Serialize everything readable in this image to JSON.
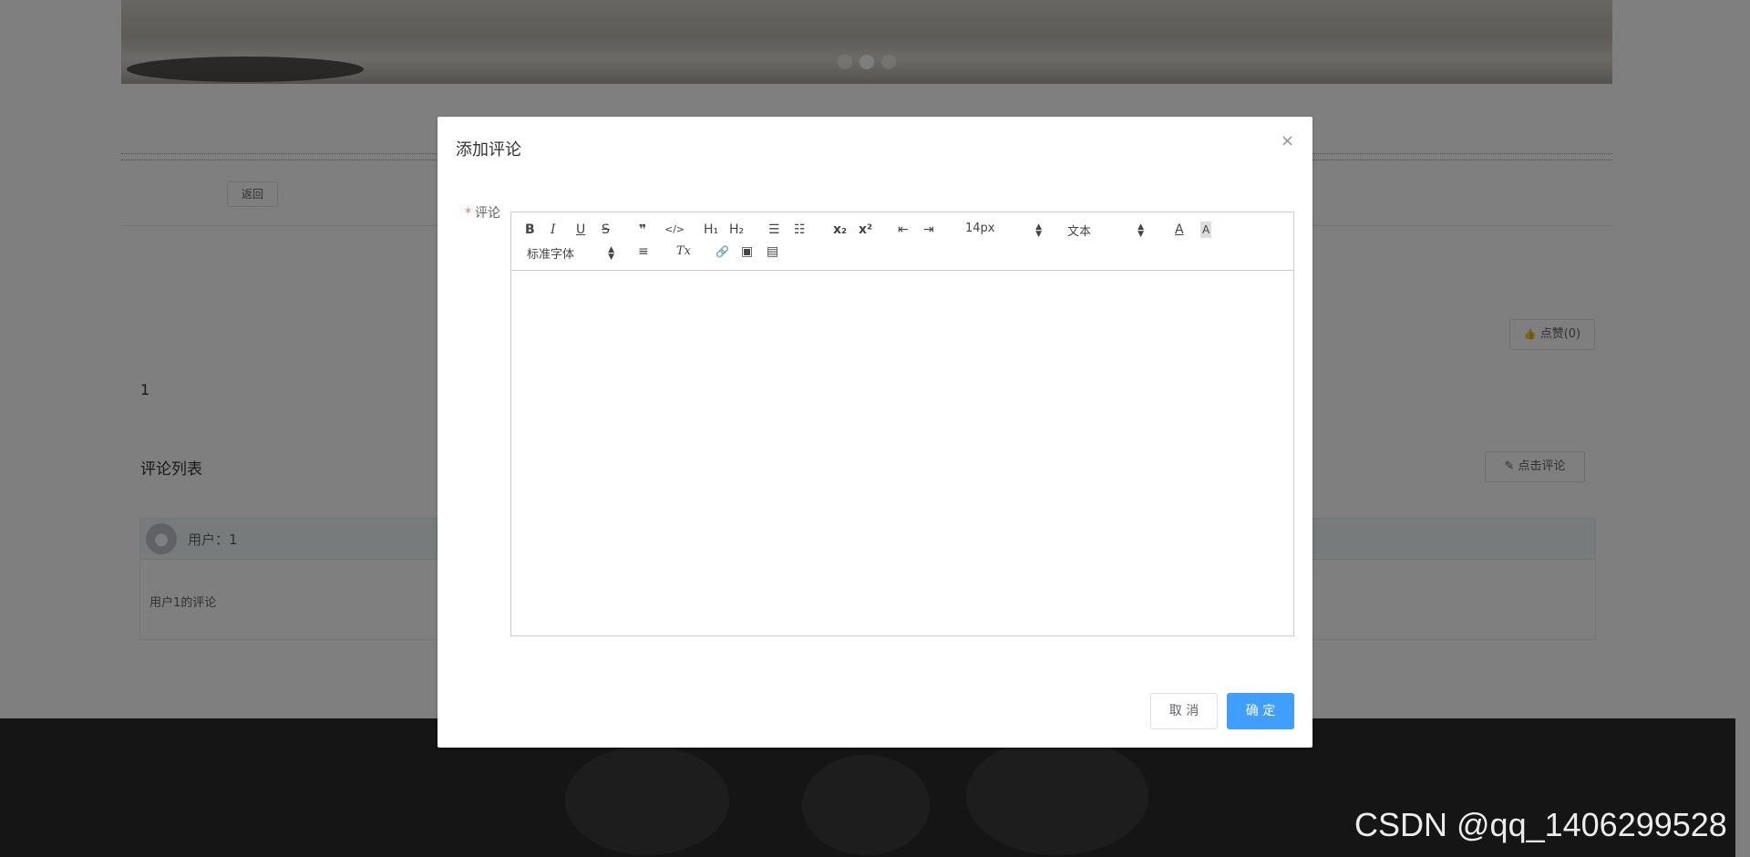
{
  "page": {
    "back_label": "返回",
    "like_label": "点赞(0)",
    "article_content": "1",
    "comment_list_title": "评论列表",
    "comment_button_label": "点击评论",
    "comments": [
      {
        "user": "用户：1",
        "text": "用户1的评论"
      }
    ]
  },
  "dialog": {
    "title": "添加评论",
    "close_label": "×",
    "field_required_mark": "*",
    "field_label": "评论",
    "editor": {
      "font_size": "14px",
      "header_select": "文本",
      "font_family": "标准字体",
      "content": ""
    },
    "cancel_label": "取 消",
    "confirm_label": "确 定"
  },
  "watermark": "CSDN @qq_1406299528",
  "icons": {
    "bold": "B",
    "italic": "I",
    "underline": "U",
    "strike": "S",
    "blockquote": "❞",
    "code": "</>",
    "h1": "H₁",
    "h2": "H₂",
    "ordered_list": "☰",
    "bullet_list": "☷",
    "subscript": "x₂",
    "superscript": "x²",
    "outdent": "⇤",
    "indent": "⇥",
    "font_color": "A",
    "background_color": "A",
    "align": "≡",
    "clean": "Tx",
    "link": "🔗",
    "image": "▣",
    "video": "▤",
    "like": "👍",
    "edit": "✎"
  },
  "colors": {
    "primary": "#409eff",
    "required": "#f56c6c",
    "mask": "rgba(0,0,0,0.5)"
  }
}
